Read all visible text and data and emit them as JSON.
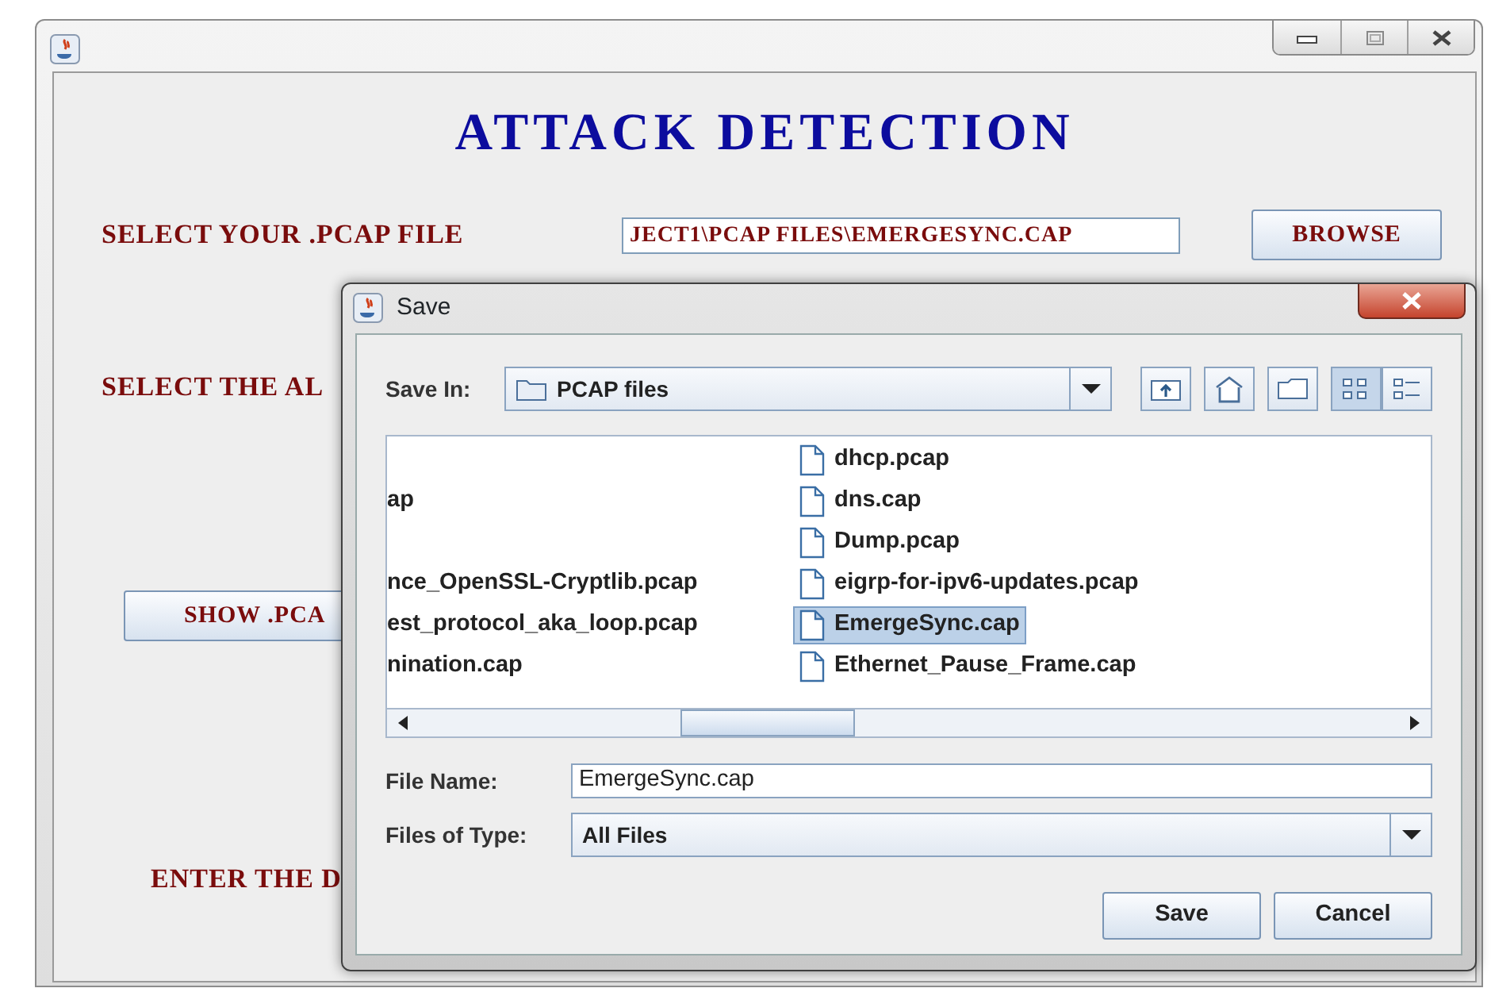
{
  "main_window": {
    "heading": "ATTACK DETECTION",
    "file_label": "SELECT YOUR .PCAP FILE",
    "file_path": "JECT1\\PCAP FILES\\EMERGESYNC.CAP",
    "browse_button": "BROWSE",
    "algorithm_label": "SELECT THE AL",
    "show_button": "SHOW .PCA",
    "enter_label": "ENTER THE D"
  },
  "save_dialog": {
    "title": "Save",
    "save_in_label": "Save In:",
    "save_in_value": "PCAP files",
    "view_buttons": [
      {
        "kind": "list",
        "selected": true
      },
      {
        "kind": "details",
        "selected": false
      }
    ],
    "file_rows": [
      {
        "right": {
          "name": "dhcp.pcap",
          "selected": false
        }
      },
      {
        "left": "ap",
        "right": {
          "name": "dns.cap",
          "selected": false
        }
      },
      {
        "right": {
          "name": "Dump.pcap",
          "selected": false
        }
      },
      {
        "left": "nce_OpenSSL-Cryptlib.pcap",
        "right": {
          "name": "eigrp-for-ipv6-updates.pcap",
          "selected": false
        }
      },
      {
        "left": "est_protocol_aka_loop.pcap",
        "right": {
          "name": "EmergeSync.cap",
          "selected": true
        }
      },
      {
        "left": "nination.cap",
        "right": {
          "name": "Ethernet_Pause_Frame.cap",
          "selected": false
        }
      }
    ],
    "file_name_label": "File Name:",
    "file_name_value": "EmergeSync.cap",
    "type_label": "Files of Type:",
    "type_value": "All Files",
    "buttons": [
      "Save",
      "Cancel"
    ]
  }
}
